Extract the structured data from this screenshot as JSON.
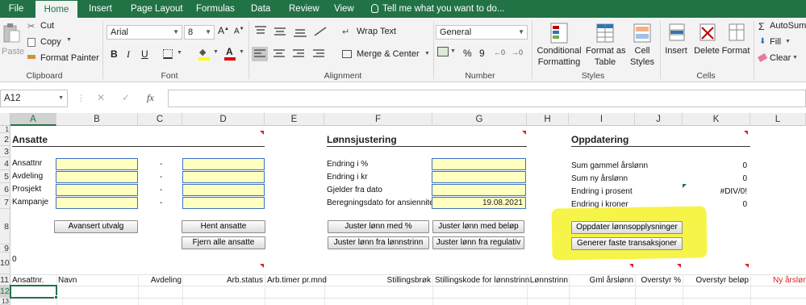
{
  "ribbon_tabs": [
    "File",
    "Home",
    "Insert",
    "Page Layout",
    "Formulas",
    "Data",
    "Review",
    "View"
  ],
  "active_tab": "Home",
  "tell_me": "Tell me what you want to do...",
  "clipboard": {
    "paste": "Paste",
    "cut": "Cut",
    "copy": "Copy",
    "format_painter": "Format Painter",
    "label": "Clipboard"
  },
  "font": {
    "name": "Arial",
    "size": "8",
    "label": "Font",
    "bold": "B",
    "italic": "I",
    "underline": "U",
    "font_color_letter": "A"
  },
  "alignment": {
    "wrap_text": "Wrap Text",
    "merge_center": "Merge & Center",
    "label": "Alignment"
  },
  "number": {
    "format": "General",
    "percent": "%",
    "comma": "9",
    "label": "Number"
  },
  "styles": {
    "conditional": "Conditional",
    "formatting": "Formatting",
    "format_as": "Format as",
    "table": "Table",
    "cell": "Cell",
    "cell_styles": "Styles",
    "label": "Styles"
  },
  "cells": {
    "insert": "Insert",
    "delete": "Delete",
    "format": "Format",
    "label": "Cells"
  },
  "editing": {
    "autosum": "AutoSum",
    "fill": "Fill",
    "clear": "Clear"
  },
  "formula_bar": {
    "name_box": "A12",
    "cancel": "✕",
    "enter": "✓",
    "fx": "fx",
    "value": ""
  },
  "columns": [
    "A",
    "B",
    "C",
    "D",
    "E",
    "F",
    "G",
    "H",
    "I",
    "J",
    "K",
    "L"
  ],
  "selected_column": "A",
  "rows": [
    "1",
    "2",
    "3",
    "4",
    "5",
    "6",
    "7",
    "8",
    "9",
    "10",
    "11",
    "12",
    "13"
  ],
  "selected_row": "12",
  "sheet": {
    "ansatte_title": "Ansatte",
    "ansatte_labels": [
      "Ansattnr",
      "Avdeling",
      "Prosjekt",
      "Kampanje"
    ],
    "dashes": [
      "-",
      "-",
      "-",
      "-"
    ],
    "btn_avansert": "Avansert utvalg",
    "btn_hent": "Hent ansatte",
    "btn_fjern": "Fjern alle ansatte",
    "lonn_title": "Lønnsjustering",
    "lonn_labels": [
      "Endring i %",
      "Endring i kr",
      "Gjelder fra dato",
      "Beregningsdato for ansiennitet"
    ],
    "beregningsdato": "19.08.2021",
    "btn_juster_pct": "Juster lønn med %",
    "btn_juster_belop": "Juster lønn med beløp",
    "btn_juster_trinn": "Juster lønn fra lønnstrinn",
    "btn_juster_reg": "Juster lønn fra regulativ",
    "oppd_title": "Oppdatering",
    "oppd_labels": [
      "Sum gammel årslønn",
      "Sum ny årslønn",
      "Endring i prosent",
      "Endring i kroner"
    ],
    "oppd_values": [
      "0",
      "0",
      "#DIV/0!",
      "0"
    ],
    "btn_oppdater": "Oppdater lønnsopplysninger",
    "btn_generer": "Generer faste transaksjoner",
    "a10_value": "0",
    "header_row": [
      "Ansattnr.",
      "Navn",
      "Avdeling",
      "Arb.status",
      "Arb.timer pr.mnd",
      "Stillingsbrøk",
      "Stillingskode for lønnstrinn",
      "Lønnstrinn",
      "Gml årslønn",
      "Overstyr %",
      "Overstyr beløp",
      "Ny årslønn"
    ]
  },
  "colors": {
    "excel_green": "#217346",
    "input_fill": "#ffffc0",
    "highlight": "#f6f33a",
    "comment_red": "#e02020"
  }
}
